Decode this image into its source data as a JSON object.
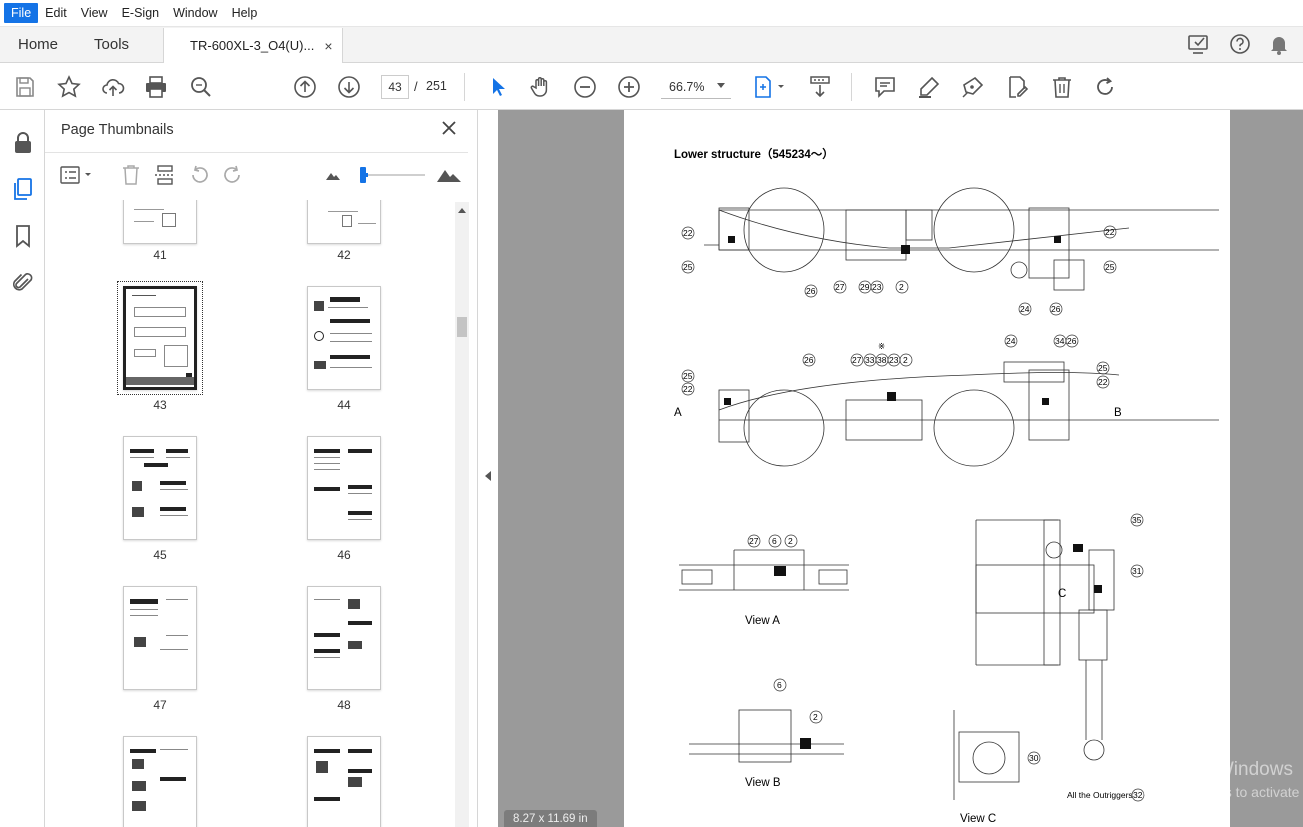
{
  "menu": {
    "items": [
      "File",
      "Edit",
      "View",
      "E-Sign",
      "Window",
      "Help"
    ],
    "active_index": 0
  },
  "tabs": {
    "home": "Home",
    "tools": "Tools",
    "document": "TR-600XL-3_O4(U)...",
    "close": "×"
  },
  "toolbar": {
    "current_page": "43",
    "separator": "/",
    "total_pages": "251",
    "zoom": "66.7%"
  },
  "panel": {
    "title": "Page Thumbnails",
    "thumbnails": [
      "41",
      "42",
      "43",
      "44",
      "45",
      "46",
      "47",
      "48",
      "",
      ""
    ],
    "selected_page": "43"
  },
  "document": {
    "title": "Lower structure（545234～）",
    "view_a": "View A",
    "view_b": "View B",
    "view_c": "View C",
    "arrow_a": "A",
    "arrow_b": "B",
    "arrow_c": "C",
    "all_outriggers": "All the Outriggers",
    "asterisk": "※",
    "callouts_top": [
      "22",
      "25",
      "26",
      "27",
      "29",
      "23",
      "2",
      "22",
      "25",
      "24",
      "26"
    ],
    "callouts_mid": [
      "25",
      "22",
      "26",
      "27",
      "33",
      "38",
      "23",
      "2",
      "24",
      "34",
      "26",
      "25",
      "22"
    ],
    "callouts_viewa": [
      "27",
      "6",
      "2"
    ],
    "callouts_viewb": [
      "6",
      "2"
    ],
    "callouts_right": [
      "35",
      "31",
      "30",
      "32"
    ],
    "page_size": "8.27 x 11.69 in"
  },
  "watermark": {
    "line1": "Activate Windows",
    "line2": "Go to Settings to activate"
  },
  "colors": {
    "accent": "#1473e6",
    "doc_bg": "#9a9a9a",
    "toolbar_bg": "#ffffff",
    "tab_bg": "#f3f3f3"
  }
}
